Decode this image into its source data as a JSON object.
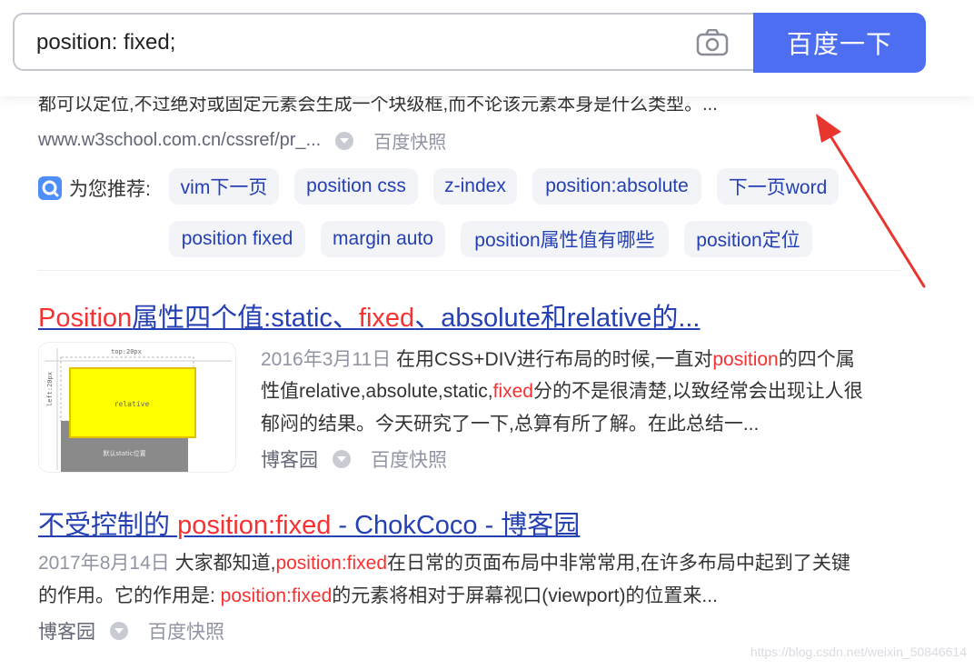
{
  "search": {
    "query": "position: fixed;",
    "button_label": "百度一下"
  },
  "prev_result": {
    "snippet_cut": "都可以定位,不过绝对或固定元素会生成一个块级框,而不论该元素本身是什么类型。...",
    "url": "www.w3school.com.cn/cssref/pr_...",
    "snapshot": "百度快照"
  },
  "recommend": {
    "label": "为您推荐:",
    "chips": [
      "vim下一页",
      "position css",
      "z-index",
      "position:absolute",
      "下一页word",
      "position fixed",
      "margin auto",
      "position属性值有哪些",
      "position定位"
    ]
  },
  "result1": {
    "title_parts": [
      "Position",
      "属性四个值:static、",
      "fixed",
      "、absolute和relative的..."
    ],
    "date": "2016年3月11日",
    "line1_a": "在用CSS+DIV进行布局的时候,一直对",
    "line1_em": "position",
    "line1_b": "的四个属",
    "line2_a": "性值relative,absolute,static,",
    "line2_em": "fixed",
    "line2_b": "分的不是很清楚,以致经常会出现让人很",
    "line3": "郁闷的结果。今天研究了一下,总算有所了解。在此总结一...",
    "source": "博客园",
    "snapshot": "百度快照",
    "thumb": {
      "top_label": "top:20px",
      "side_label": "left:20px",
      "box_label": "relative",
      "bottom_label": "默认static位置"
    }
  },
  "result2": {
    "title_a": "不受控制的 ",
    "title_em": "position:fixed",
    "title_b": " - ChokCoco - 博客园",
    "date": "2017年8月14日",
    "line1_a": "大家都知道,",
    "line1_em": "position:fixed",
    "line1_b": "在日常的页面布局中非常常用,在许多布局中起到了关键",
    "line2_a": "的作用。它的作用是: ",
    "line2_em": "position:fixed",
    "line2_b": "的元素将相对于屏幕视口(viewport)的位置来...",
    "source": "博客园",
    "snapshot": "百度快照"
  },
  "watermark": "https://blog.csdn.net/weixin_50846614",
  "colors": {
    "brand": "#4e6ef2",
    "link": "#2440b3",
    "highlight": "#f73131",
    "arrow": "#e8362f"
  }
}
